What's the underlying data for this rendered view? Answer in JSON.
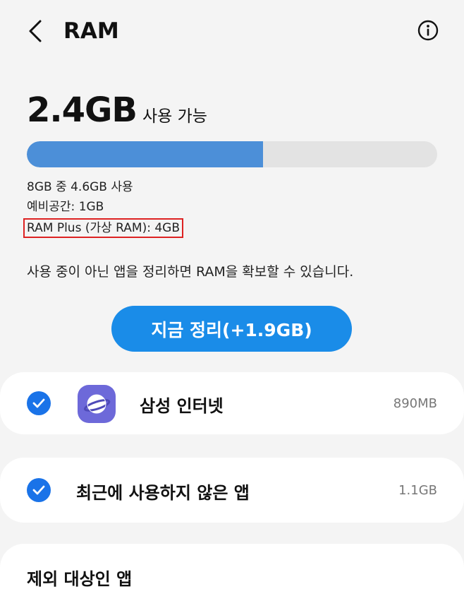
{
  "header": {
    "title": "RAM",
    "back_icon": "chevron-left-icon",
    "info_icon": "info-circle-icon"
  },
  "summary": {
    "available_value": "2.4GB",
    "available_label": "사용 가능",
    "usage_fraction": 0.575
  },
  "details": {
    "usage": "8GB 중 4.6GB 사용",
    "reserve": "예비공간: 1GB",
    "ram_plus": "RAM Plus (가상 RAM): 4GB"
  },
  "description": "사용 중이 아닌 앱을 정리하면 RAM을 확보할 수 있습니다.",
  "clean_button": {
    "label": "지금 정리(+1.9GB)"
  },
  "apps": [
    {
      "name": "삼성 인터넷",
      "size": "890MB",
      "checked": true,
      "icon": "samsung-internet-icon"
    },
    {
      "name": "최근에 사용하지 않은 앱",
      "size": "1.1GB",
      "checked": true
    }
  ],
  "excluded": {
    "label": "제외 대상인 앱"
  },
  "colors": {
    "accent": "#1a8ce8",
    "progress_fill": "#4c8fd8",
    "check": "#1a73e8",
    "highlight_box": "#dd2222",
    "app_icon": "#6d69d9"
  }
}
